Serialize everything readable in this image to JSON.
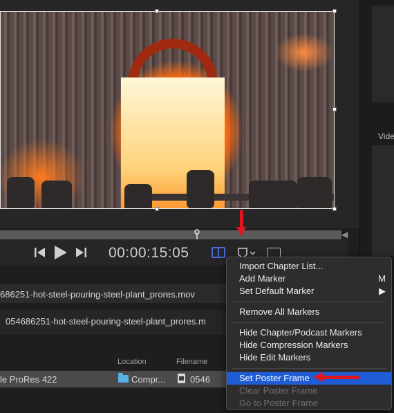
{
  "viewer": {
    "timecode": "00:00:15:05"
  },
  "side_panel": {
    "label": "Vide"
  },
  "files": {
    "row1": "686251-hot-steel-pouring-steel-plant_prores.mov",
    "row2": "054686251-hot-steel-pouring-steel-plant_prores.m"
  },
  "table": {
    "headers": {
      "location": "Location",
      "filename": "Filename"
    },
    "row": {
      "format": "le ProRes 422",
      "location": "Compr...",
      "filename": "0546"
    }
  },
  "menu": {
    "items": [
      {
        "label": "Import Chapter List...",
        "shortcut": "",
        "enabled": true
      },
      {
        "label": "Add Marker",
        "shortcut": "M",
        "enabled": true
      },
      {
        "label": "Set Default Marker",
        "shortcut": "▶",
        "enabled": true
      },
      {
        "label": "Remove All Markers",
        "shortcut": "",
        "enabled": true
      },
      {
        "label": "Hide Chapter/Podcast Markers",
        "shortcut": "",
        "enabled": true
      },
      {
        "label": "Hide Compression Markers",
        "shortcut": "",
        "enabled": true
      },
      {
        "label": "Hide Edit Markers",
        "shortcut": "",
        "enabled": true
      },
      {
        "label": "Set Poster Frame",
        "shortcut": "",
        "enabled": true,
        "highlighted": true
      },
      {
        "label": "Clear Poster Frame",
        "shortcut": "",
        "enabled": false
      },
      {
        "label": "Go to Poster Frame",
        "shortcut": "",
        "enabled": false
      }
    ]
  },
  "colors": {
    "highlight": "#1f5dd6",
    "annotation_arrow": "#e0161f",
    "chapter_button": "#4a6ad8"
  },
  "icons": [
    "previous-frame-icon",
    "play-icon",
    "next-frame-icon",
    "chapter-view-icon",
    "marker-icon",
    "chevron-down-icon",
    "caption-icon",
    "folder-icon",
    "file-icon"
  ]
}
